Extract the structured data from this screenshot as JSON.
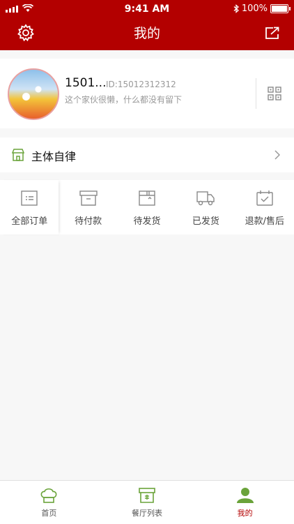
{
  "status_bar": {
    "time": "9:41 AM",
    "battery": "100%"
  },
  "header": {
    "title": "我的",
    "settings_icon": "gear-icon",
    "share_icon": "share-icon"
  },
  "profile": {
    "name": "1501...",
    "id": "ID:15012312312",
    "signature": "这个家伙很懒，什么都没有留下",
    "qr_icon": "qr-code-icon"
  },
  "section": {
    "label": "主体自律",
    "icon": "store-icon"
  },
  "orders": [
    {
      "label": "全部订单",
      "icon": "order-list-icon"
    },
    {
      "label": "待付款",
      "icon": "payment-box-icon"
    },
    {
      "label": "待发货",
      "icon": "package-icon"
    },
    {
      "label": "已发货",
      "icon": "truck-icon"
    },
    {
      "label": "退款/售后",
      "icon": "calendar-check-icon"
    }
  ],
  "tabbar": [
    {
      "label": "首页",
      "icon": "chef-hat-icon",
      "active": false
    },
    {
      "label": "餐厅列表",
      "icon": "restaurant-icon",
      "active": false
    },
    {
      "label": "我的",
      "icon": "user-icon",
      "active": true
    }
  ],
  "colors": {
    "accent": "#b30000",
    "tab_green": "#6aa33a"
  }
}
